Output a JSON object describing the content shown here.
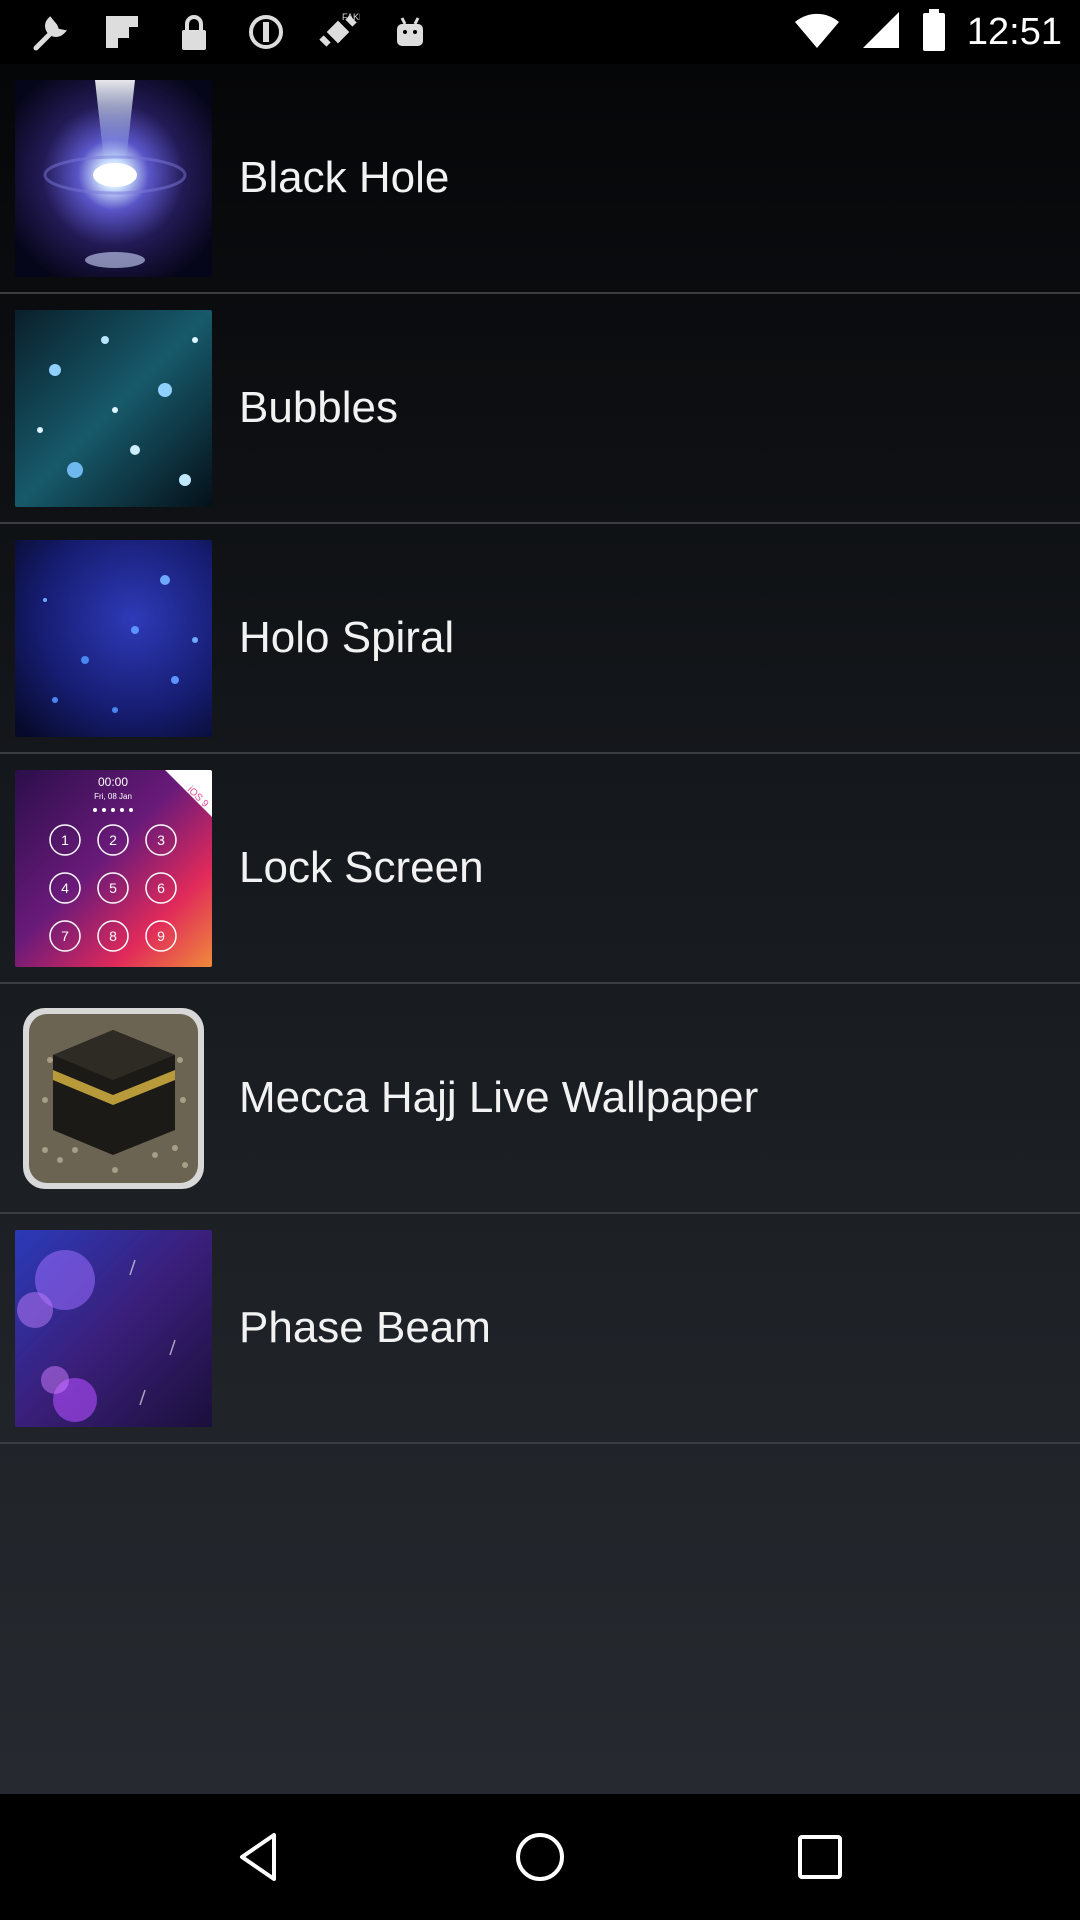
{
  "status_bar": {
    "time": "12:51",
    "left_icons": [
      "wrench-icon",
      "flipboard-icon",
      "lock-icon",
      "data-saver-icon",
      "fake-gps-icon",
      "android-icon"
    ],
    "right_icons": [
      "wifi-icon",
      "signal-icon",
      "battery-icon"
    ]
  },
  "wallpapers": [
    {
      "label": "Black Hole",
      "thumbnail": "black-hole-thumbnail"
    },
    {
      "label": "Bubbles",
      "thumbnail": "bubbles-thumbnail"
    },
    {
      "label": "Holo Spiral",
      "thumbnail": "holo-spiral-thumbnail"
    },
    {
      "label": "Lock Screen",
      "thumbnail": "lock-screen-thumbnail",
      "thumb_text": {
        "time": "00:00",
        "date": "Fri, 08 Jan",
        "badge": "iOS 9",
        "keys": [
          "1",
          "2",
          "3",
          "4",
          "5",
          "6",
          "7",
          "8",
          "9"
        ]
      }
    },
    {
      "label": "Mecca Hajj Live Wallpaper",
      "thumbnail": "mecca-thumbnail"
    },
    {
      "label": "Phase Beam",
      "thumbnail": "phase-beam-thumbnail"
    }
  ],
  "nav_bar": {
    "buttons": [
      "back-icon",
      "home-icon",
      "recents-icon"
    ]
  },
  "colors": {
    "background_top": "#050608",
    "background_bottom": "#262a30",
    "divider": "#3a3d42",
    "text": "#f2f2f2"
  }
}
